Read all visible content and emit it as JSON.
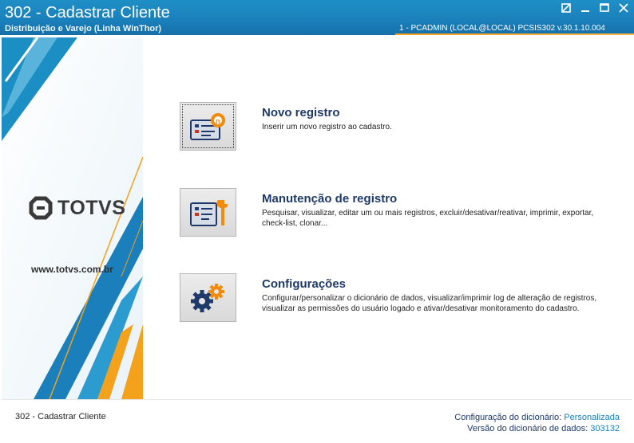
{
  "window": {
    "title": "302 - Cadastrar Cliente",
    "subtitle": "Distribuição e Varejo (Linha WinThor)",
    "status": "1 - PCADMIN (LOCAL@LOCAL)   PCSIS302   v.30.1.10.004",
    "controls": [
      "minimize-restore",
      "minimize",
      "maximize",
      "close"
    ]
  },
  "sidebar": {
    "logo_text": "TOTVS",
    "website": "www.totvs.com.br"
  },
  "options": [
    {
      "title": "Novo registro",
      "description": "Inserir um novo registro ao cadastro.",
      "icon": "new-record-icon"
    },
    {
      "title": "Manutenção de registro",
      "description": "Pesquisar, visualizar, editar um ou mais registros, excluir/desativar/reativar, imprimir, exportar, check-list,  clonar...",
      "icon": "maintenance-icon"
    },
    {
      "title": "Configurações",
      "description": "Configurar/personalizar o dicionário de dados, visualizar/imprimir log de alteração de registros, visualizar as permissões do usuário logado e ativar/desativar monitoramento do cadastro.",
      "icon": "settings-gears-icon"
    }
  ],
  "footer": {
    "left": "302 - Cadastrar Cliente",
    "dict_config_label": "Configuração do dicionário:",
    "dict_config_value": "Personalizada",
    "dict_version_label": "Versão do dicionário de dados:",
    "dict_version_value": "303132"
  },
  "colors": {
    "titlebar": "#1a7fba",
    "accent_orange": "#f4a11c",
    "link_blue": "#1f3a6a"
  }
}
